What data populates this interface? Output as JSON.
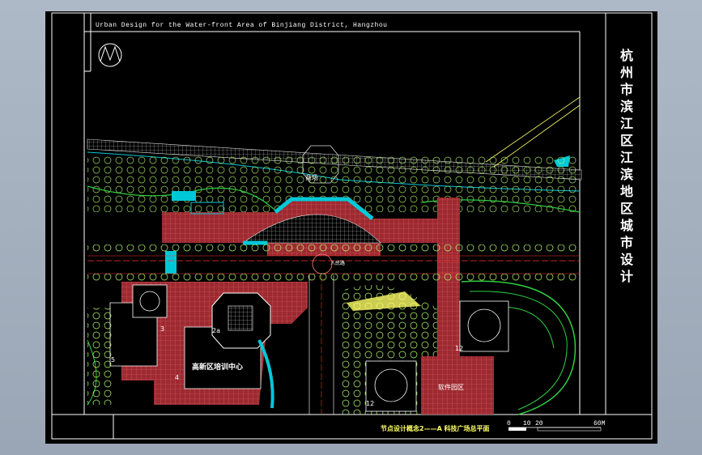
{
  "header": {
    "title_en": "Urban  Design  for  the  Water-front Area of Binjiang District, Hangzhou",
    "title_cn": "杭州市滨江区江滨地区城市设计"
  },
  "drawing": {
    "caption": "节点设计概念2——A 科技广场总平面",
    "labels": {
      "plaza_north": "商场",
      "training_center": "高新区培训中心",
      "park_east": "软件园区",
      "road_label": "人民路",
      "num_2a": "2a",
      "num_3": "3",
      "num_4": "4",
      "num_5": "5",
      "num_12a": "12",
      "num_12b": "12"
    },
    "scale_bar": {
      "marks": [
        "0",
        "10",
        "20",
        "60M"
      ]
    }
  },
  "colors": {
    "background": "#000000",
    "paving": "#c0323a",
    "water": "#00c8d8",
    "vegetation": "#2ecc40",
    "road_line": "#ff3030",
    "frame": "#ffffff"
  }
}
